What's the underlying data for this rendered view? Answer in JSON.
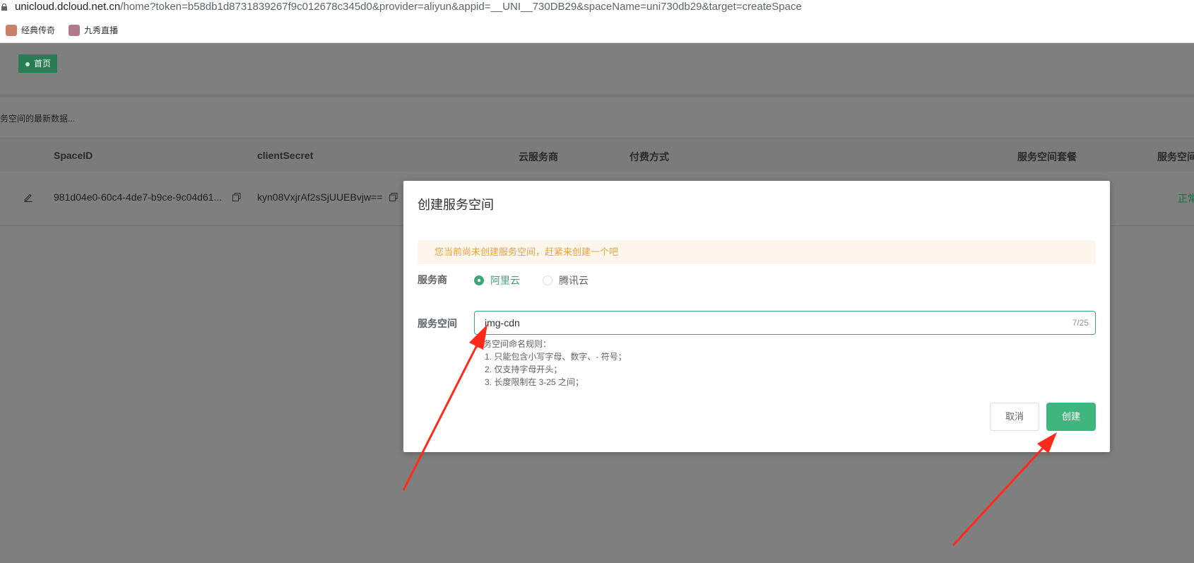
{
  "browser": {
    "url_host": "unicloud.dcloud.net.cn",
    "url_path": "/home?token=b58db1d8731839267f9c012678c345d0&provider=aliyun&appid=__UNI__730DB29&spaceName=uni730db29&target=createSpace",
    "bookmarks": [
      "经典传奇",
      "九秀直播"
    ]
  },
  "page": {
    "breadcrumb": "首页",
    "tip": "服务空间的最新数据...",
    "columns": [
      "SpaceID",
      "clientSecret",
      "云服务商",
      "付费方式",
      "服务空间套餐",
      "服务空间"
    ],
    "row": {
      "space_id": "981d04e0-60c4-4de7-b9ce-9c04d61...",
      "client_secret": "kyn08VxjrAf2sSjUUEBvjw==",
      "status": "正常"
    }
  },
  "modal": {
    "title": "创建服务空间",
    "alert": "您当前尚未创建服务空间，赶紧来创建一个吧",
    "provider_label": "服务商",
    "providers": [
      {
        "label": "阿里云",
        "checked": true
      },
      {
        "label": "腾讯云",
        "checked": false
      }
    ],
    "space_label": "服务空间",
    "space_value": "img-cdn",
    "counter": "7/25",
    "rules": [
      "服务空间命名规则：",
      "1. 只能包含小写字母、数字、- 符号；",
      "2. 仅支持字母开头；",
      "3. 长度限制在 3-25 之间；"
    ],
    "cancel_label": "取消",
    "create_label": "创建"
  },
  "colors": {
    "accent": "#3eb67d",
    "annotation": "#ff2a1a",
    "overlay": "#7f7f7f"
  }
}
